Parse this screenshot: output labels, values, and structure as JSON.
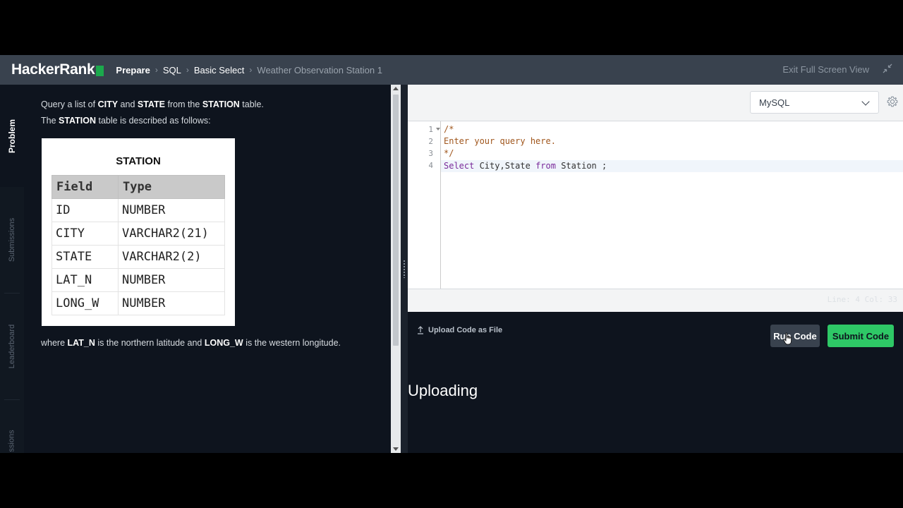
{
  "header": {
    "logo": "HackerRank",
    "breadcrumbs": [
      "Prepare",
      "SQL",
      "Basic Select",
      "Weather Observation Station 1"
    ],
    "exit_label": "Exit Full Screen View"
  },
  "side_tabs": [
    "Problem",
    "Submissions",
    "Leaderboard",
    "ssions"
  ],
  "problem": {
    "line1": {
      "t1": "Query a list of ",
      "b1": "CITY",
      "t2": " and ",
      "b2": "STATE",
      "t3": " from the ",
      "b3": "STATION",
      "t4": " table."
    },
    "line2": {
      "t1": "The ",
      "b1": "STATION",
      "t2": " table is described as follows:"
    },
    "image_title": "STATION",
    "table": {
      "headers": [
        "Field",
        "Type"
      ],
      "rows": [
        [
          "ID",
          "NUMBER"
        ],
        [
          "CITY",
          "VARCHAR2(21)"
        ],
        [
          "STATE",
          "VARCHAR2(2)"
        ],
        [
          "LAT_N",
          "NUMBER"
        ],
        [
          "LONG_W",
          "NUMBER"
        ]
      ]
    },
    "line3": {
      "t1": "where ",
      "b1": "LAT_N",
      "t2": " is the northern latitude and ",
      "b2": "LONG_W",
      "t3": " is the western longitude."
    }
  },
  "editor": {
    "language": "MySQL",
    "line_numbers": [
      "1",
      "2",
      "3",
      "4"
    ],
    "lines": [
      "/*",
      "Enter your query here.",
      "*/",
      "Select City,State from Station ;"
    ],
    "kw_select": "Select",
    "kw_from": "from",
    "status": "Line: 4 Col: 33"
  },
  "actions": {
    "upload_label": "Upload Code as File",
    "run_label": "Run Code",
    "submit_label": "Submit Code"
  },
  "output": {
    "status_text": "Uploading"
  },
  "colors": {
    "header_bg": "#39424e",
    "page_bg": "#0e141e",
    "accent_green": "#2ec866",
    "logo_green": "#1ba94c"
  }
}
